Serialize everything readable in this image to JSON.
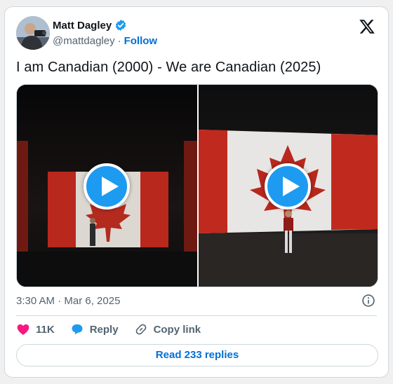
{
  "author": {
    "name": "Matt Dagley",
    "handle": "@mattdagley",
    "separator": "·",
    "follow_label": "Follow",
    "verified": true
  },
  "tweet": {
    "text": "I am Canadian (2000) - We are Canadian (2025)",
    "timestamp": "3:30 AM · Mar 6, 2025"
  },
  "media": {
    "items": [
      {
        "type": "video",
        "icon": "play-icon"
      },
      {
        "type": "video",
        "icon": "play-icon"
      }
    ]
  },
  "actions": {
    "like_count": "11K",
    "reply_label": "Reply",
    "copy_link_label": "Copy link"
  },
  "footer": {
    "read_replies_label": "Read 233 replies"
  },
  "colors": {
    "accent": "#1d9bf0",
    "link": "#006fd6",
    "like": "#f91880",
    "muted": "#536471",
    "border": "#cfd9de"
  }
}
